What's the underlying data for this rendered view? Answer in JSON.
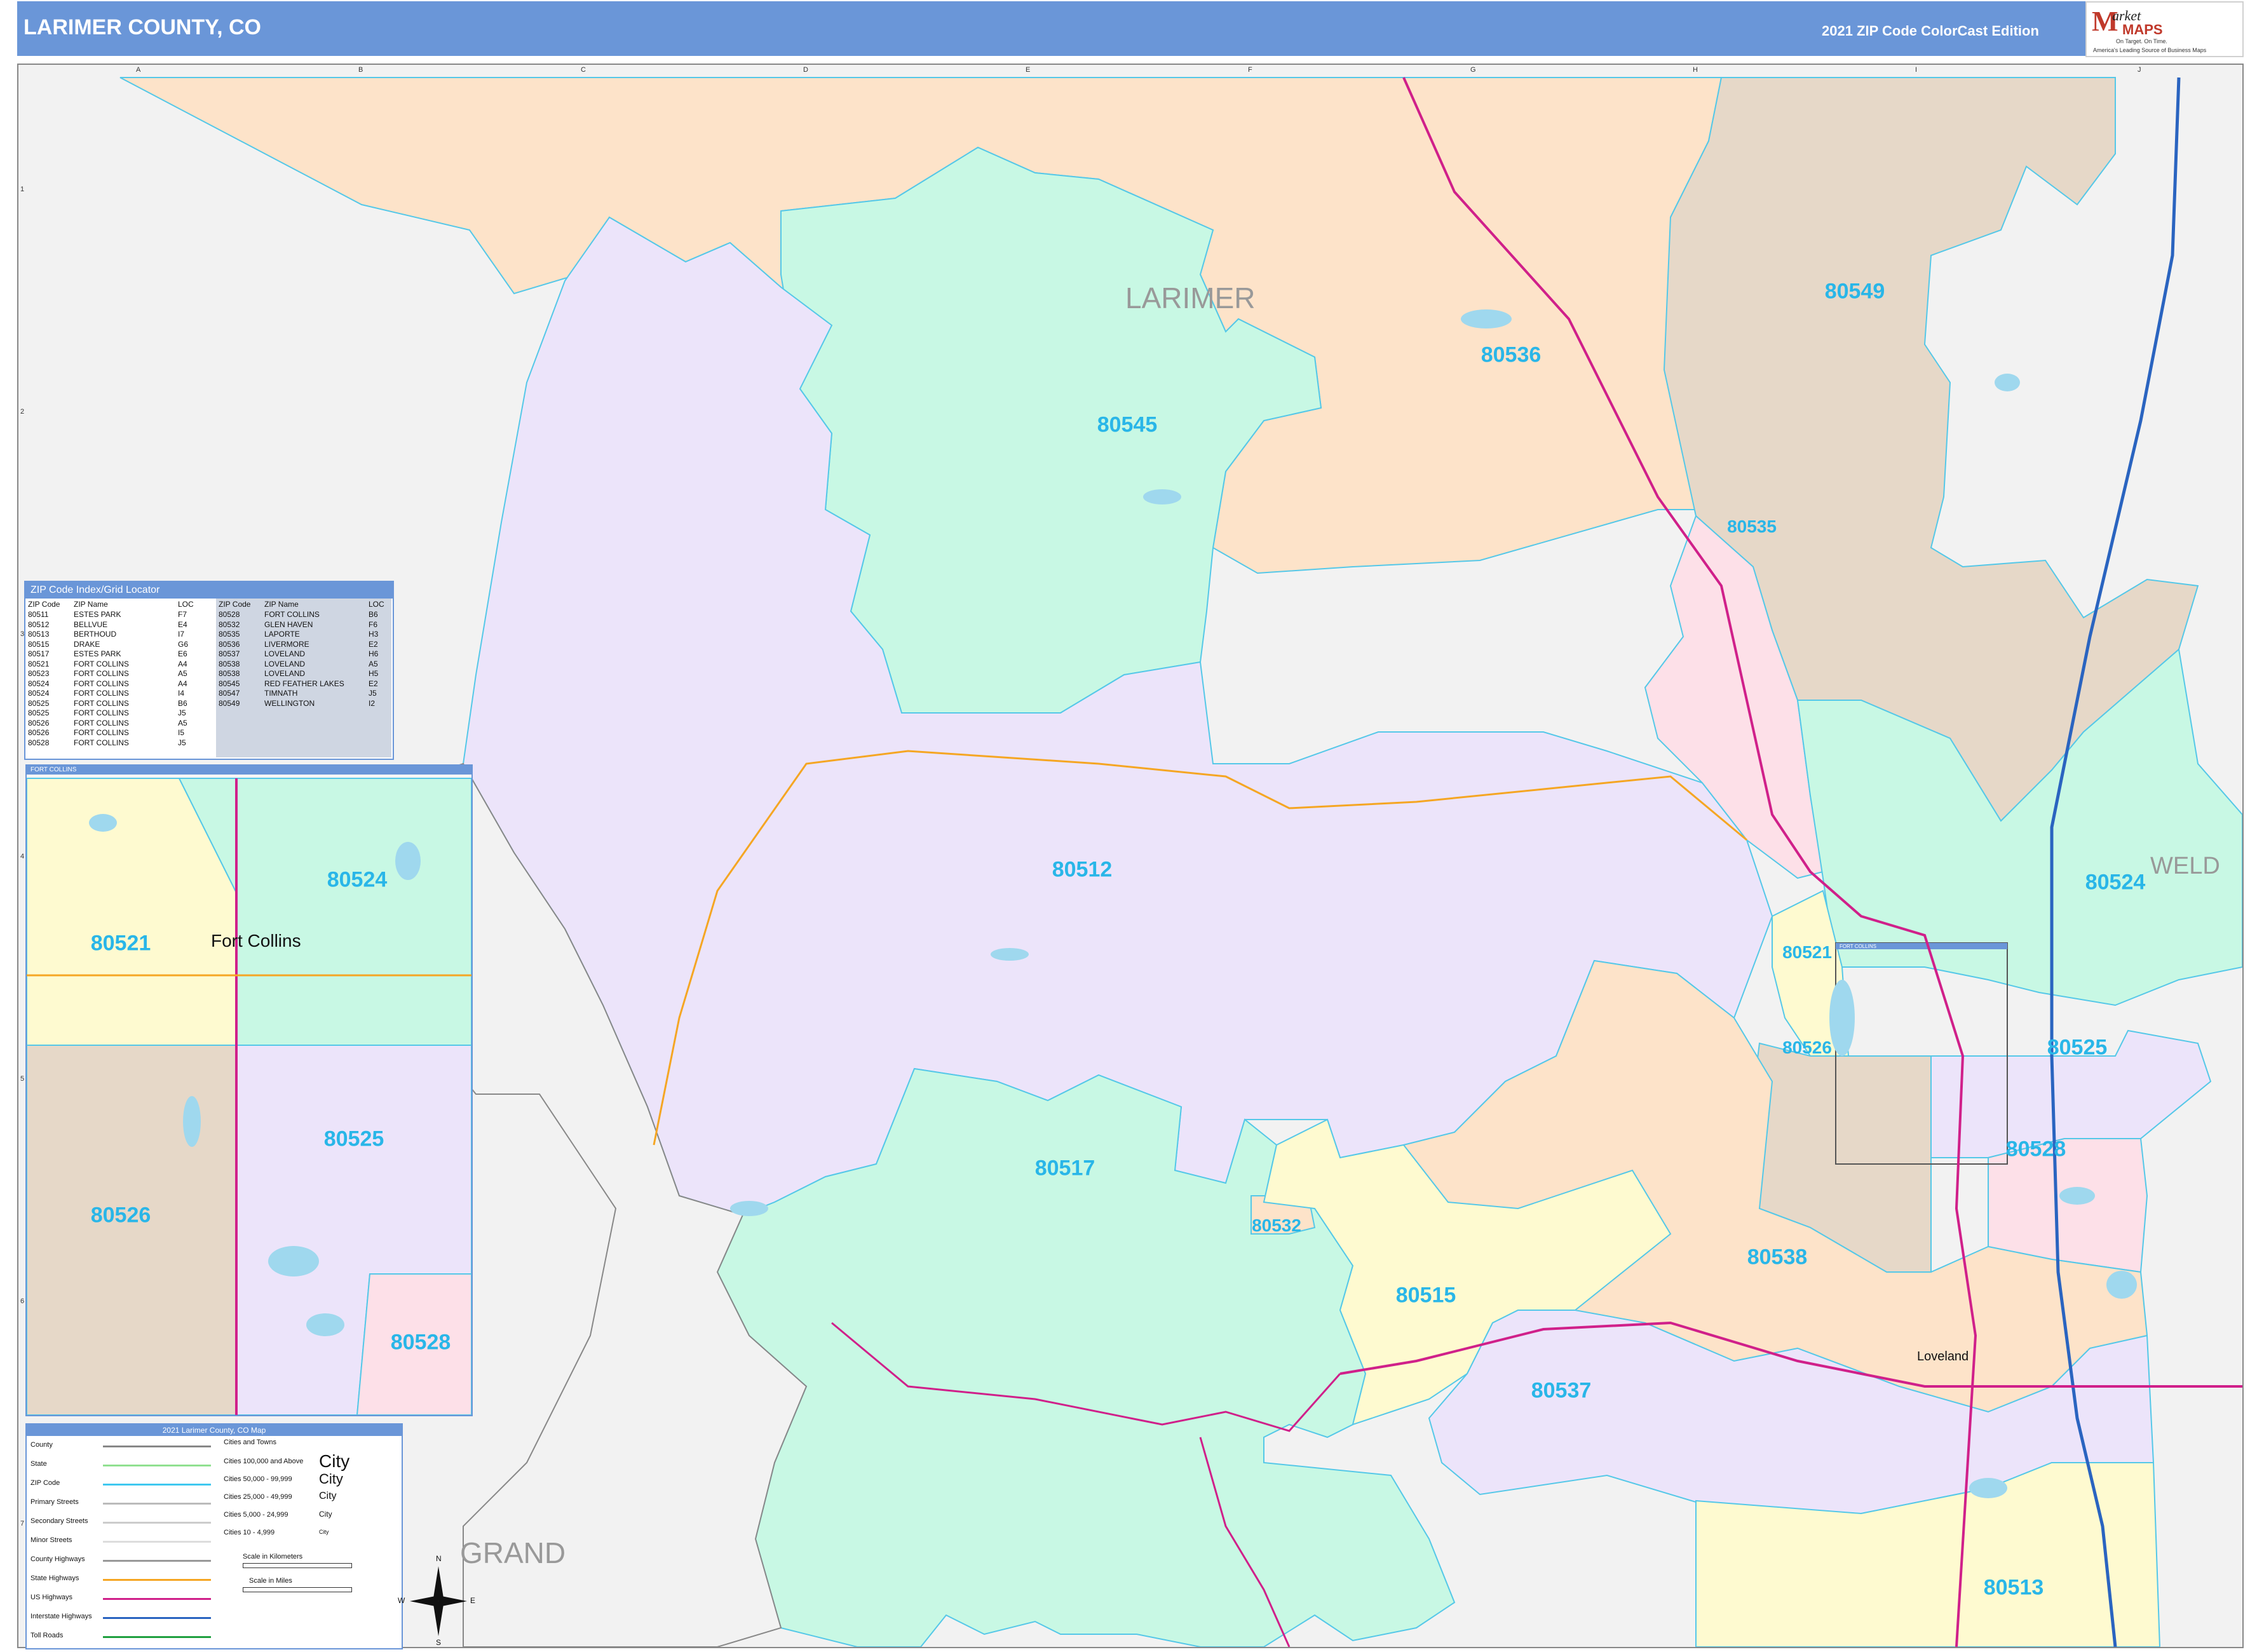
{
  "header": {
    "title": "LARIMER COUNTY, CO",
    "edition": "2021 ZIP Code ColorCast Edition",
    "logo_letter": "M",
    "logo_market": "arket",
    "logo_maps": "MAPS",
    "logo_tagline": "On Target. On Time.",
    "logo_tagline2": "America's Leading Source of Business Maps"
  },
  "grid": {
    "letters": [
      "A",
      "B",
      "C",
      "D",
      "E",
      "F",
      "G",
      "H",
      "I",
      "J"
    ],
    "numbers": [
      "1",
      "2",
      "3",
      "4",
      "5",
      "6",
      "7"
    ]
  },
  "regions": {
    "larimer": "LARIMER",
    "weld": "WELD",
    "grand": "GRAND"
  },
  "zip_labels": [
    "80549",
    "80536",
    "80545",
    "80535",
    "80512",
    "80524",
    "80521",
    "80525",
    "80526",
    "80528",
    "80517",
    "80532",
    "80515",
    "80538",
    "80537",
    "80513"
  ],
  "zip_index": {
    "title": "ZIP Code Index/Grid Locator",
    "headers": [
      "ZIP Code",
      "ZIP Name",
      "LOC",
      "ZIP Code",
      "ZIP Name",
      "LOC"
    ],
    "left": [
      [
        "80511",
        "ESTES PARK",
        "F7"
      ],
      [
        "80512",
        "BELLVUE",
        "E4"
      ],
      [
        "80513",
        "BERTHOUD",
        "I7"
      ],
      [
        "80515",
        "DRAKE",
        "G6"
      ],
      [
        "80517",
        "ESTES PARK",
        "E6"
      ],
      [
        "80521",
        "FORT COLLINS",
        "A4"
      ],
      [
        "80523",
        "FORT COLLINS",
        "A5"
      ],
      [
        "80524",
        "FORT COLLINS",
        "A4"
      ],
      [
        "80524",
        "FORT COLLINS",
        "I4"
      ],
      [
        "80525",
        "FORT COLLINS",
        "B6"
      ],
      [
        "80525",
        "FORT COLLINS",
        "J5"
      ],
      [
        "80526",
        "FORT COLLINS",
        "A5"
      ],
      [
        "80526",
        "FORT COLLINS",
        "I5"
      ],
      [
        "80528",
        "FORT COLLINS",
        "J5"
      ]
    ],
    "right": [
      [
        "80528",
        "FORT COLLINS",
        "B6"
      ],
      [
        "80532",
        "GLEN HAVEN",
        "F6"
      ],
      [
        "80535",
        "LAPORTE",
        "H3"
      ],
      [
        "80536",
        "LIVERMORE",
        "E2"
      ],
      [
        "80537",
        "LOVELAND",
        "H6"
      ],
      [
        "80538",
        "LOVELAND",
        "A5"
      ],
      [
        "80538",
        "LOVELAND",
        "H5"
      ],
      [
        "80545",
        "RED FEATHER LAKES",
        "E2"
      ],
      [
        "80547",
        "TIMNATH",
        "J5"
      ],
      [
        "80549",
        "WELLINGTON",
        "I2"
      ]
    ]
  },
  "inset": {
    "title": "FORT COLLINS",
    "city": "Fort Collins",
    "zips": [
      "80524",
      "80521",
      "80525",
      "80526",
      "80528"
    ]
  },
  "map_cities": {
    "loveland": "Loveland",
    "inset_marker": "FORT COLLINS"
  },
  "legend": {
    "title": "2021 Larimer County, CO Map",
    "items": [
      "County",
      "State",
      "ZIP Code",
      "Primary Streets",
      "Secondary Streets",
      "Minor Streets",
      "County Highways",
      "State Highways",
      "US Highways",
      "Interstate Highways",
      "Toll Roads"
    ],
    "colors": [
      "#888888",
      "#90e090",
      "#40c8f0",
      "#bbbbbb",
      "#cccccc",
      "#dddddd",
      "#999999",
      "#f5a623",
      "#d0208a",
      "#2a64c0",
      "#20a040"
    ],
    "cities_header": "Cities and Towns",
    "city_sizes": [
      "Cities 100,000 and Above",
      "Cities 50,000 - 99,999",
      "Cities 25,000 - 49,999",
      "Cities 5,000 - 24,999",
      "Cities 10 - 4,999"
    ],
    "city_samples": [
      "City",
      "City",
      "City",
      "City",
      "City"
    ],
    "scale_km": "Scale in Kilometers",
    "scale_mi": "Scale in Miles",
    "compass": [
      "N",
      "S",
      "E",
      "W"
    ]
  }
}
